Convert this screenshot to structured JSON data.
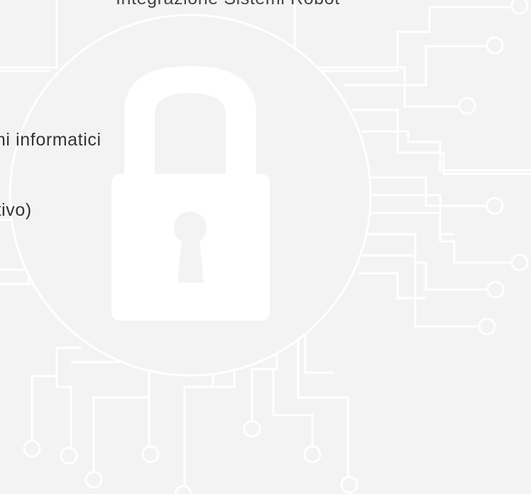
{
  "header": {
    "title": "Integrazione Sistemi Robot"
  },
  "content": {
    "line1": "mi informatici",
    "line2": "ttivo)"
  },
  "illustration": {
    "icon": "padlock-icon",
    "background": "circuit-board-pattern",
    "colors": {
      "background": "#f3f3f3",
      "lines": "#ffffff",
      "lock": "#ffffff",
      "text": "#333333"
    }
  }
}
